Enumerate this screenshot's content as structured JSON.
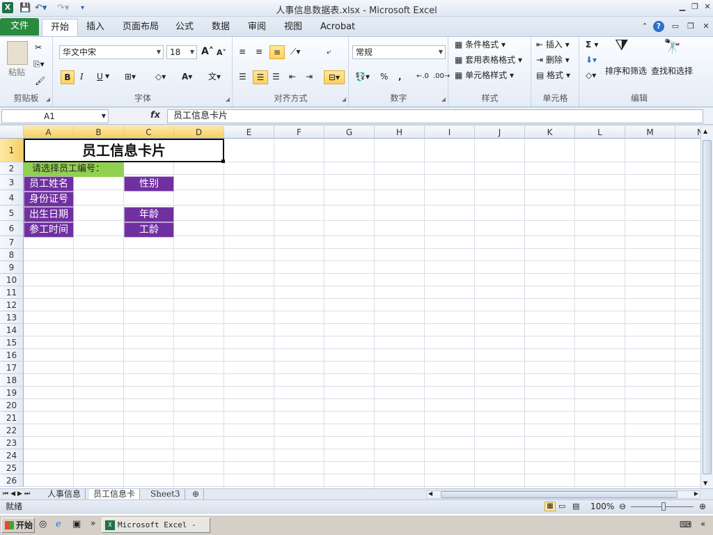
{
  "window": {
    "title": "人事信息数据表.xlsx  -  Microsoft Excel",
    "app_icon": "excel-x-icon"
  },
  "qat": {
    "save_icon": "save-icon",
    "undo_icon": "undo-icon",
    "redo_icon": "redo-icon",
    "customize_icon": "customize-qat-icon"
  },
  "tabs": [
    {
      "label": "文件"
    },
    {
      "label": "开始"
    },
    {
      "label": "插入"
    },
    {
      "label": "页面布局"
    },
    {
      "label": "公式"
    },
    {
      "label": "数据"
    },
    {
      "label": "审阅"
    },
    {
      "label": "视图"
    },
    {
      "label": "Acrobat"
    }
  ],
  "ribbon": {
    "clipboard": {
      "label": "剪贴板",
      "paste": "粘贴"
    },
    "font": {
      "label": "字体",
      "name": "华文中宋",
      "size": "18",
      "bold": "B",
      "italic": "I",
      "underline": "U"
    },
    "align": {
      "label": "对齐方式"
    },
    "number": {
      "label": "数字",
      "format": "常规",
      "percent": "%",
      "comma": ","
    },
    "styles": {
      "label": "样式",
      "conditional": "条件格式",
      "table": "套用表格格式",
      "cell": "单元格样式"
    },
    "cells": {
      "label": "单元格",
      "insert": "插入",
      "delete": "删除",
      "format": "格式"
    },
    "editing": {
      "label": "编辑",
      "sum": "Σ",
      "sort": "排序和筛选",
      "find": "查找和选择"
    }
  },
  "formula_bar": {
    "name_box": "A1",
    "fx": "fx",
    "content": "员工信息卡片"
  },
  "grid": {
    "columns": [
      "A",
      "B",
      "C",
      "D",
      "E",
      "F",
      "G",
      "H",
      "I",
      "J",
      "K",
      "L",
      "M",
      "N"
    ],
    "rows": [
      "1",
      "2",
      "3",
      "4",
      "5",
      "6",
      "7",
      "8",
      "9",
      "10",
      "11",
      "12",
      "13",
      "14",
      "15",
      "16",
      "17",
      "18",
      "19",
      "20",
      "21",
      "22",
      "23",
      "24",
      "25",
      "26"
    ],
    "title": "员工信息卡片",
    "prompt": "请选择员工编号：",
    "labels": {
      "name": "员工姓名",
      "gender": "性别",
      "id_number": "身份证号",
      "birth_date": "出生日期",
      "age": "年龄",
      "join_date": "参工时间",
      "seniority": "工龄"
    },
    "accent_purple": "#7030a0",
    "accent_green": "#92d050"
  },
  "sheets": [
    "人事信息",
    "员工信息卡",
    "Sheet3"
  ],
  "status": {
    "ready": "就绪",
    "zoom": "100%"
  },
  "taskbar": {
    "start": "开始",
    "app": "Microsoft Excel - ..."
  }
}
